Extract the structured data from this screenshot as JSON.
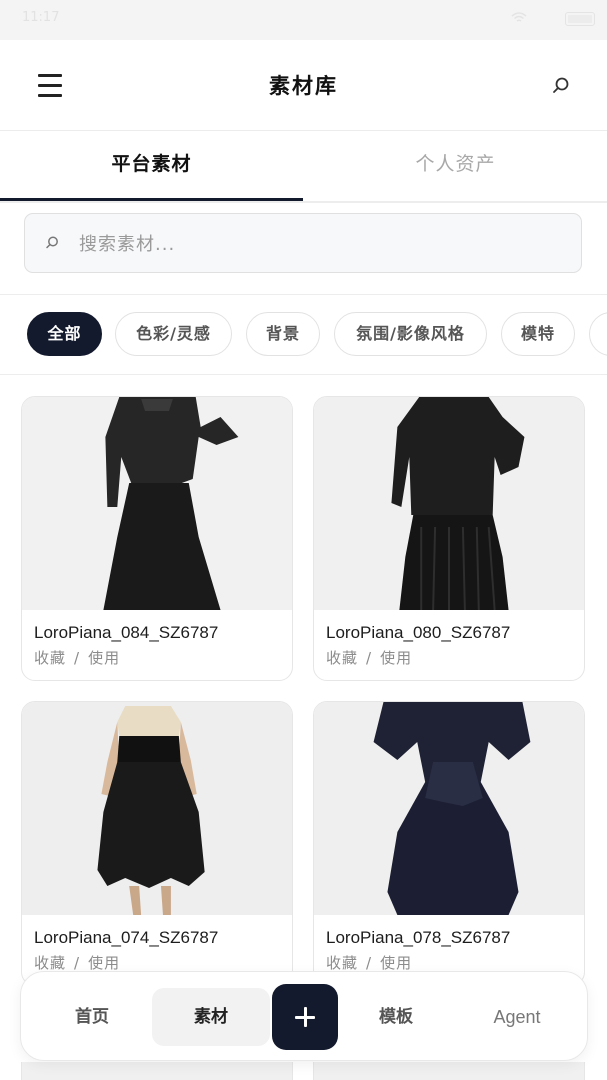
{
  "status_bar": {
    "time": "11:17"
  },
  "header": {
    "title": "素材库"
  },
  "tabs": [
    {
      "label": "平台素材",
      "active": true
    },
    {
      "label": "个人资产",
      "active": false
    }
  ],
  "search": {
    "placeholder": "搜索素材..."
  },
  "chips": [
    {
      "label": "全部",
      "active": true
    },
    {
      "label": "色彩/灵感",
      "active": false
    },
    {
      "label": "背景",
      "active": false
    },
    {
      "label": "氛围/影像风格",
      "active": false
    },
    {
      "label": "模特",
      "active": false
    }
  ],
  "materials": [
    {
      "name": "LoroPiana_084_SZ6787",
      "favorite": "收藏",
      "separator": "/",
      "use": "使用"
    },
    {
      "name": "LoroPiana_080_SZ6787",
      "favorite": "收藏",
      "separator": "/",
      "use": "使用"
    },
    {
      "name": "LoroPiana_074_SZ6787",
      "favorite": "收藏",
      "separator": "/",
      "use": "使用"
    },
    {
      "name": "LoroPiana_078_SZ6787",
      "favorite": "收藏",
      "separator": "/",
      "use": "使用"
    }
  ],
  "bottom_nav": {
    "items": [
      {
        "label": "首页",
        "active": false
      },
      {
        "label": "素材",
        "active": true
      },
      {
        "label": "模板",
        "active": false
      },
      {
        "label": "Agent",
        "active": false
      }
    ],
    "add_icon": "plus-icon"
  },
  "colors": {
    "accent": "#141a2e",
    "muted_text": "#9a9a9a",
    "border": "#e6e6e6"
  }
}
